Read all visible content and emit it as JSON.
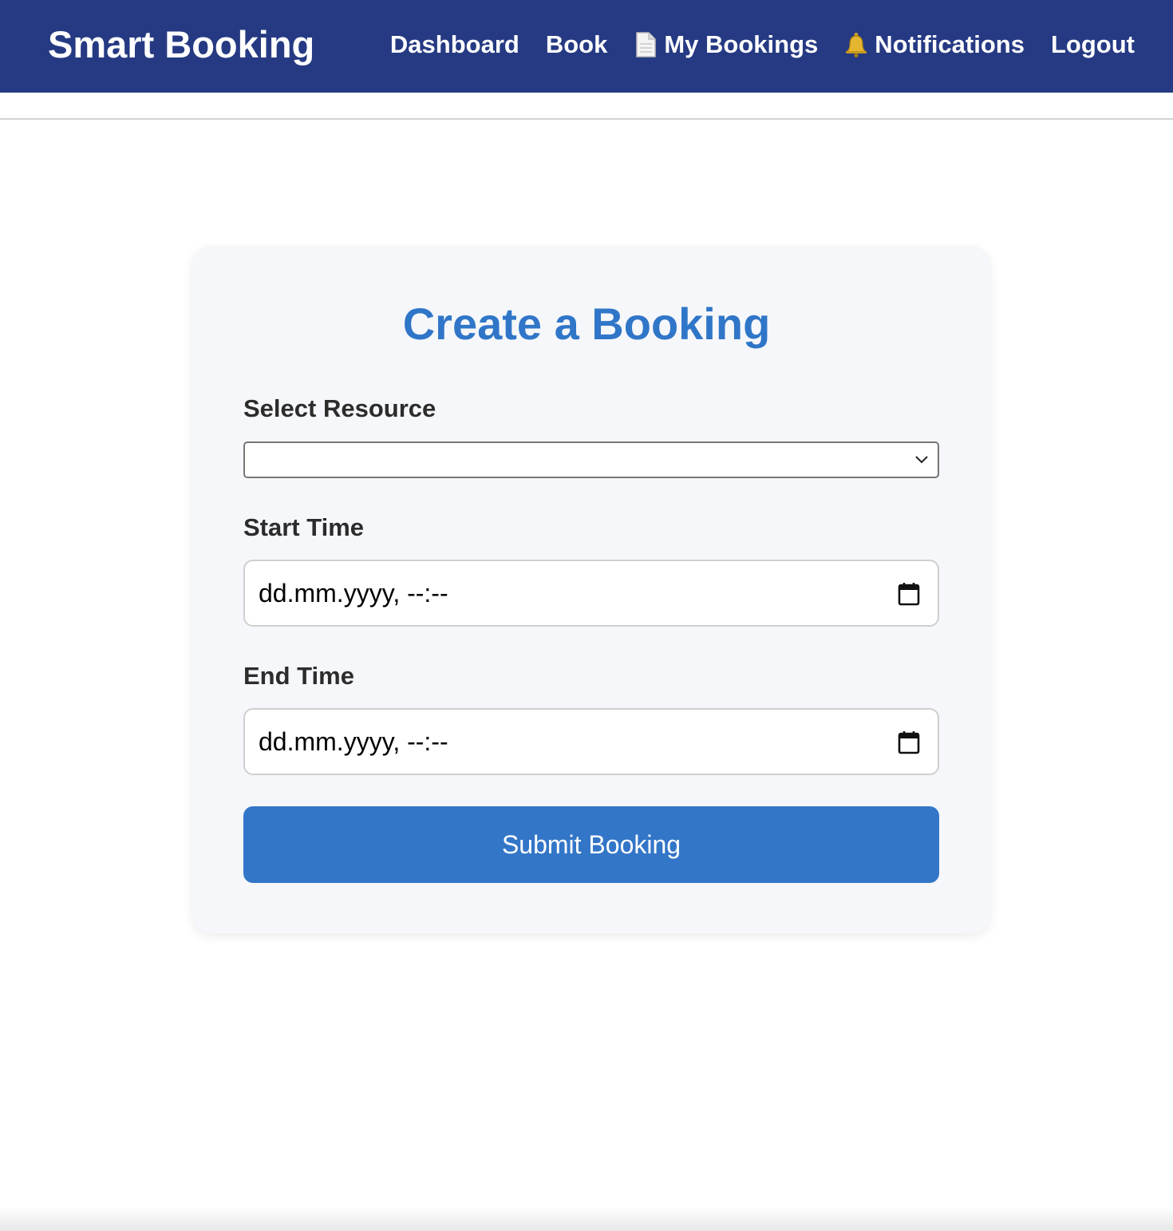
{
  "app": {
    "brand": "Smart Booking"
  },
  "nav": {
    "dashboard": "Dashboard",
    "book": "Book",
    "my_bookings": "My Bookings",
    "notifications": "Notifications",
    "logout": "Logout",
    "my_bookings_icon": "document-icon",
    "notifications_icon": "bell-icon"
  },
  "form": {
    "title": "Create a Booking",
    "resource_label": "Select Resource",
    "resource_value": "",
    "start_label": "Start Time",
    "start_value": "dd.mm.yyyy, --:--",
    "end_label": "End Time",
    "end_value": "dd.mm.yyyy, --:--",
    "submit_label": "Submit Booking"
  },
  "colors": {
    "navbar": "#263a83",
    "accent": "#3376c8",
    "card_background": "#f6f7fa"
  }
}
